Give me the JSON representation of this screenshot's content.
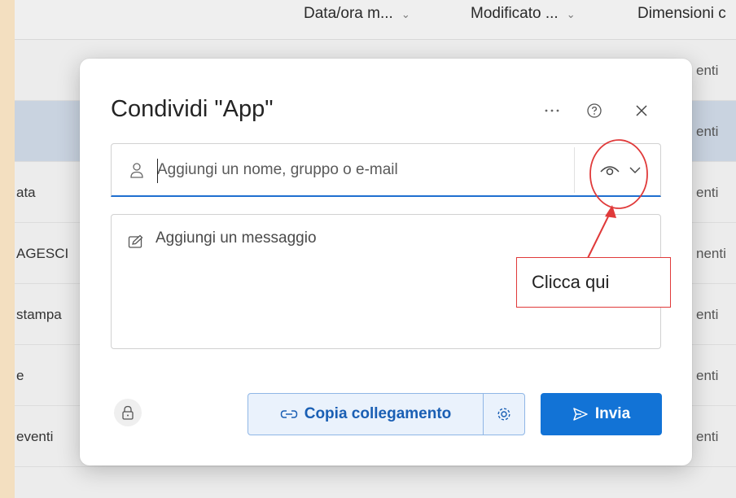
{
  "background": {
    "columns": [
      "Data/ora m...",
      "Modificato ...",
      "Dimensioni c"
    ],
    "rows": [
      {
        "left": "",
        "right": "enti"
      },
      {
        "left": "",
        "right": "enti"
      },
      {
        "left": "ata",
        "right": "enti"
      },
      {
        "left": "AGESCI",
        "right": "nenti"
      },
      {
        "left": "stampa",
        "right": "enti"
      },
      {
        "left": "e",
        "right": "enti"
      },
      {
        "left": "eventi",
        "right": "enti"
      }
    ]
  },
  "dialog": {
    "title": "Condividi \"App\"",
    "header_icons": [
      "more-icon",
      "help-icon",
      "close-icon"
    ],
    "recipient": {
      "placeholder": "Aggiungi un nome, gruppo o e-mail",
      "value": ""
    },
    "permission_icons": [
      "eye-icon",
      "chevron-down-icon"
    ],
    "message": {
      "placeholder": "Aggiungi un messaggio",
      "value": ""
    },
    "copy_link_label": "Copia collegamento",
    "send_label": "Invia"
  },
  "annotation": {
    "text": "Clicca qui",
    "color": "#e03a3a"
  },
  "colors": {
    "accent": "#1273d6",
    "accent_text": "#1a5fb4",
    "accent_light": "#eaf2fc"
  }
}
